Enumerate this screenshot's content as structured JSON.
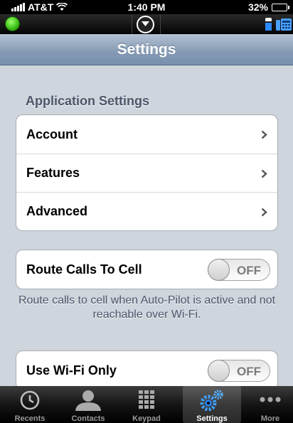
{
  "status_bar": {
    "carrier": "AT&T",
    "time": "1:40 PM",
    "battery": "32%",
    "battery_level": 0.32
  },
  "top_toolbar": {
    "presence_color": "#3fc11b",
    "icons": [
      "presence-indicator",
      "chevron-down-circle-icon",
      "mobile-phone-icon",
      "desk-phone-icon"
    ]
  },
  "nav": {
    "title": "Settings"
  },
  "application_settings": {
    "header": "Application Settings",
    "items": [
      {
        "label": "Account"
      },
      {
        "label": "Features"
      },
      {
        "label": "Advanced"
      }
    ]
  },
  "route_calls": {
    "label": "Route Calls To Cell",
    "toggle": "OFF",
    "description": "Route calls to cell when Auto-Pilot is active and not reachable over Wi-Fi."
  },
  "wifi_only": {
    "label": "Use Wi-Fi Only",
    "toggle": "OFF"
  },
  "tabs": [
    {
      "label": "Recents",
      "icon": "clock-icon"
    },
    {
      "label": "Contacts",
      "icon": "person-icon"
    },
    {
      "label": "Keypad",
      "icon": "keypad-icon"
    },
    {
      "label": "Settings",
      "icon": "gears-icon",
      "active": true
    },
    {
      "label": "More",
      "icon": "more-dots-icon"
    }
  ]
}
